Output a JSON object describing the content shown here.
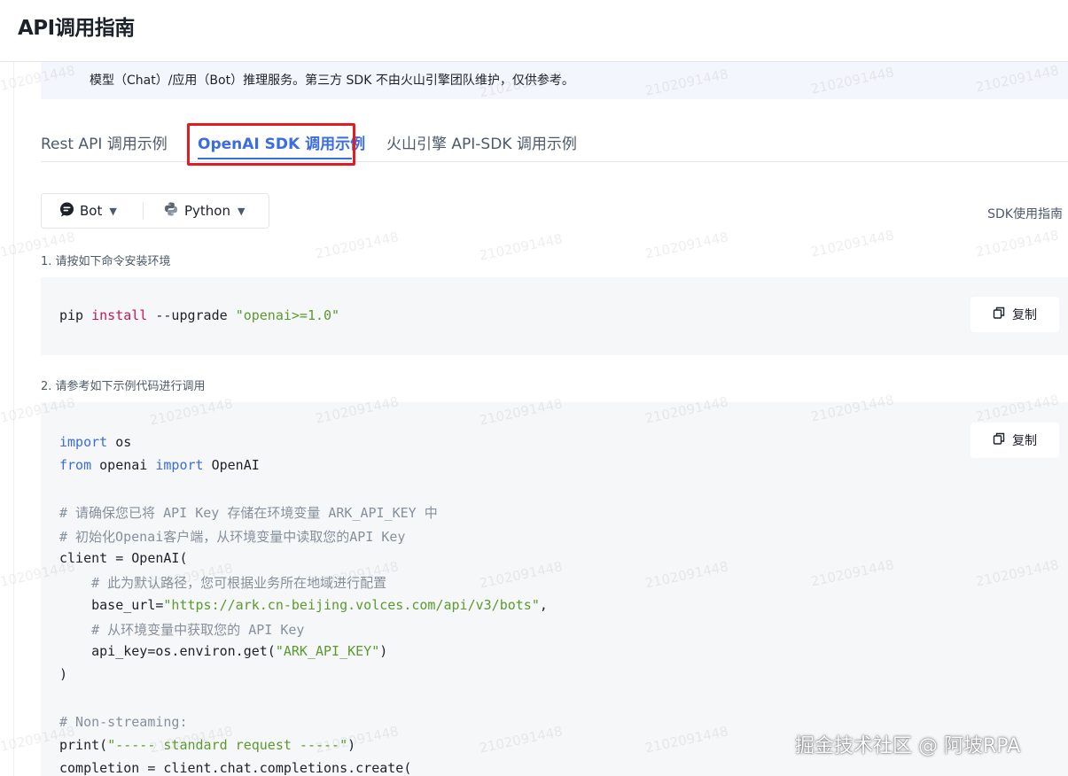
{
  "header": {
    "title": "API调用指南"
  },
  "notice": {
    "text": "模型（Chat）/应用（Bot）推理服务。第三方 SDK 不由火山引擎团队维护，仅供参考。"
  },
  "tabs": [
    {
      "label": "Rest API 调用示例"
    },
    {
      "label": "OpenAI SDK 调用示例",
      "active": true
    },
    {
      "label": "火山引擎 API-SDK 调用示例"
    }
  ],
  "selectors": {
    "type": "Bot",
    "language": "Python"
  },
  "sdk_guide_link": "SDK使用指南",
  "steps": {
    "install_label": "1. 请按如下命令安装环境",
    "example_label": "2. 请参考如下示例代码进行调用"
  },
  "install_code": {
    "pip": "pip ",
    "install": "install",
    "rest": " --upgrade ",
    "pkg": "\"openai>=1.0\""
  },
  "copy_label": "复制",
  "code": {
    "l1_kw": "import",
    "l1_rest": " os",
    "l2_kw1": "from",
    "l2_mid": " openai ",
    "l2_kw2": "import",
    "l2_rest": " OpenAI",
    "l3": "# 请确保您已将 API Key 存储在环境变量 ARK_API_KEY 中",
    "l4": "# 初始化Openai客户端，从环境变量中读取您的API Key",
    "l5": "client = OpenAI(",
    "l6": "    # 此为默认路径，您可根据业务所在地域进行配置",
    "l7_a": "    base_url=",
    "l7_str": "\"https://ark.cn-beijing.volces.com/api/v3/bots\"",
    "l7_b": ",",
    "l8": "    # 从环境变量中获取您的 API Key",
    "l9_a": "    api_key=os.environ.get(",
    "l9_str": "\"ARK_API_KEY\"",
    "l9_b": ")",
    "l10": ")",
    "l11": "# Non-streaming:",
    "l12_a": "print(",
    "l12_str": "\"----- standard request -----\"",
    "l12_b": ")",
    "l13": "completion = client.chat.completions.create("
  },
  "watermark": "2102091448",
  "corner_watermark": "掘金技术社区 @ 阿坡RPA",
  "colors": {
    "accent": "#3b6ce0",
    "highlight": "#e21c23",
    "string": "#5a9a2e",
    "comment": "#86909c"
  }
}
